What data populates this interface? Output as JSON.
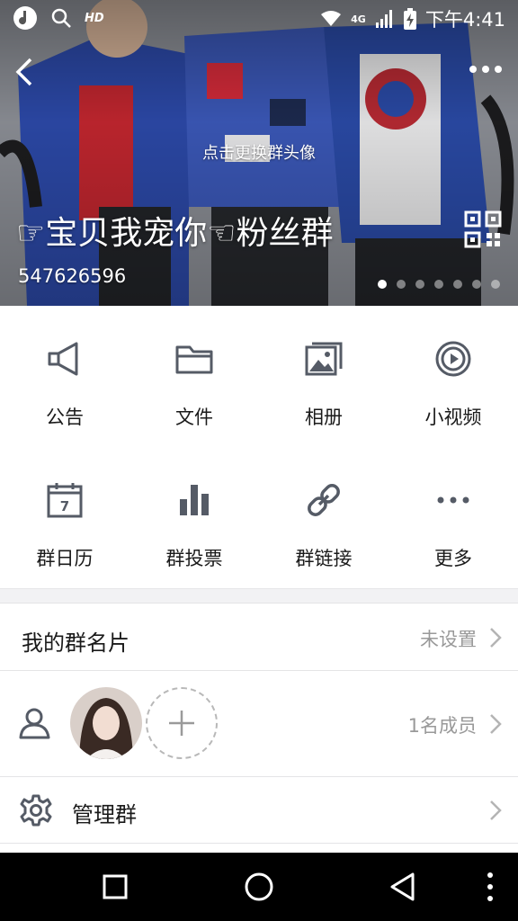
{
  "status_bar": {
    "hd_label": "HD",
    "network_label": "4G",
    "time": "下午4:41",
    "icons": [
      "music-app-icon",
      "search-icon",
      "wifi-icon",
      "cell-signal-icon",
      "battery-charging-icon"
    ]
  },
  "header": {
    "avatar_hint": "点击更换群头像",
    "group_name": "☞宝贝我宠你☜粉丝群",
    "group_id": "547626596",
    "carousel": {
      "count": 7,
      "active_index": 0
    },
    "icons": [
      "back-arrow-icon",
      "more-dots-icon",
      "qr-code-icon"
    ]
  },
  "features": [
    {
      "label": "公告",
      "icon": "megaphone-icon"
    },
    {
      "label": "文件",
      "icon": "folder-icon"
    },
    {
      "label": "相册",
      "icon": "photo-album-icon"
    },
    {
      "label": "小视频",
      "icon": "video-play-icon"
    },
    {
      "label": "群日历",
      "icon": "calendar-icon",
      "icon_text": "7"
    },
    {
      "label": "群投票",
      "icon": "bar-chart-icon"
    },
    {
      "label": "群链接",
      "icon": "link-icon"
    },
    {
      "label": "更多",
      "icon": "more-dots-icon"
    }
  ],
  "rows": {
    "card": {
      "title": "我的群名片",
      "value": "未设置"
    },
    "members": {
      "value": "1名成员"
    },
    "manage": {
      "title": "管理群"
    }
  },
  "colors": {
    "icon_gray": "#555b66",
    "text_primary": "#1a1a1a",
    "text_secondary": "#999999",
    "divider": "#e4e4e6",
    "band": "#f2f2f4"
  },
  "nav": [
    "recents-square-icon",
    "home-circle-icon",
    "back-triangle-icon",
    "overflow-dots-icon"
  ]
}
